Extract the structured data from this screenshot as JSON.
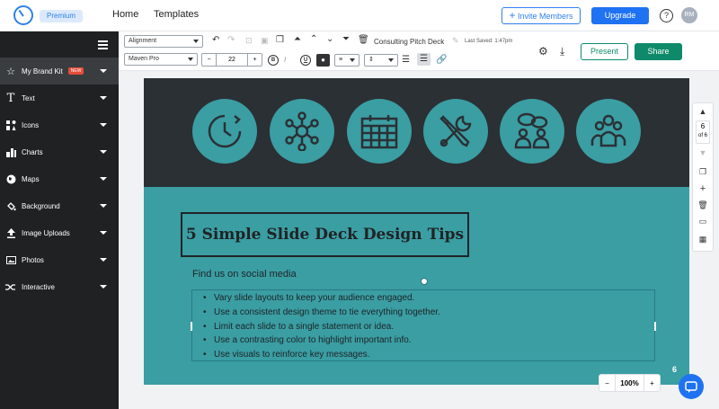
{
  "topnav": {
    "premium": "Premium",
    "links": [
      "Home",
      "Templates"
    ],
    "invite": "Invite Members",
    "upgrade": "Upgrade",
    "help": "?",
    "avatar": "RM"
  },
  "sidebar": {
    "items": [
      {
        "label": "My Brand Kit",
        "icon": "star-icon",
        "badge": "NEW"
      },
      {
        "label": "Text",
        "icon": "text-icon"
      },
      {
        "label": "Icons",
        "icon": "icons-icon"
      },
      {
        "label": "Charts",
        "icon": "charts-icon"
      },
      {
        "label": "Maps",
        "icon": "globe-icon"
      },
      {
        "label": "Background",
        "icon": "paint-bucket-icon"
      },
      {
        "label": "Image Uploads",
        "icon": "upload-icon"
      },
      {
        "label": "Photos",
        "icon": "photo-icon"
      },
      {
        "label": "Interactive",
        "icon": "shuffle-icon"
      }
    ]
  },
  "toolbar": {
    "alignment": "Alignment",
    "font": "Maven Pro",
    "font_size": "22",
    "bold": "B",
    "underline": "U",
    "doc_title": "Consulting Pitch Deck",
    "saved": "Last Saved: 1:47pm",
    "present": "Present",
    "share": "Share"
  },
  "slide": {
    "title": "5 Simple Slide Deck Design Tips",
    "subtitle": "Find us on social media",
    "tips": [
      "Vary slide layouts to keep your audience engaged.",
      "Use a consistent design theme to tie everything together.",
      "Limit each slide to a single statement or idea.",
      "Use a contrasting color to highlight important info.",
      "Use visuals to reinforce key messages."
    ],
    "icons": [
      "clock-icon",
      "network-icon",
      "calendar-icon",
      "tools-icon",
      "discussion-icon",
      "team-icon"
    ],
    "page_number": "6"
  },
  "rail": {
    "current": "6",
    "of": "of 6"
  },
  "zoom": {
    "level": "100%",
    "minus": "−",
    "plus": "+"
  },
  "colors": {
    "accent": "#1f72f2",
    "share": "#0e8a6a",
    "slide_teal": "#3a9ea3",
    "slide_dark": "#2b3035"
  }
}
